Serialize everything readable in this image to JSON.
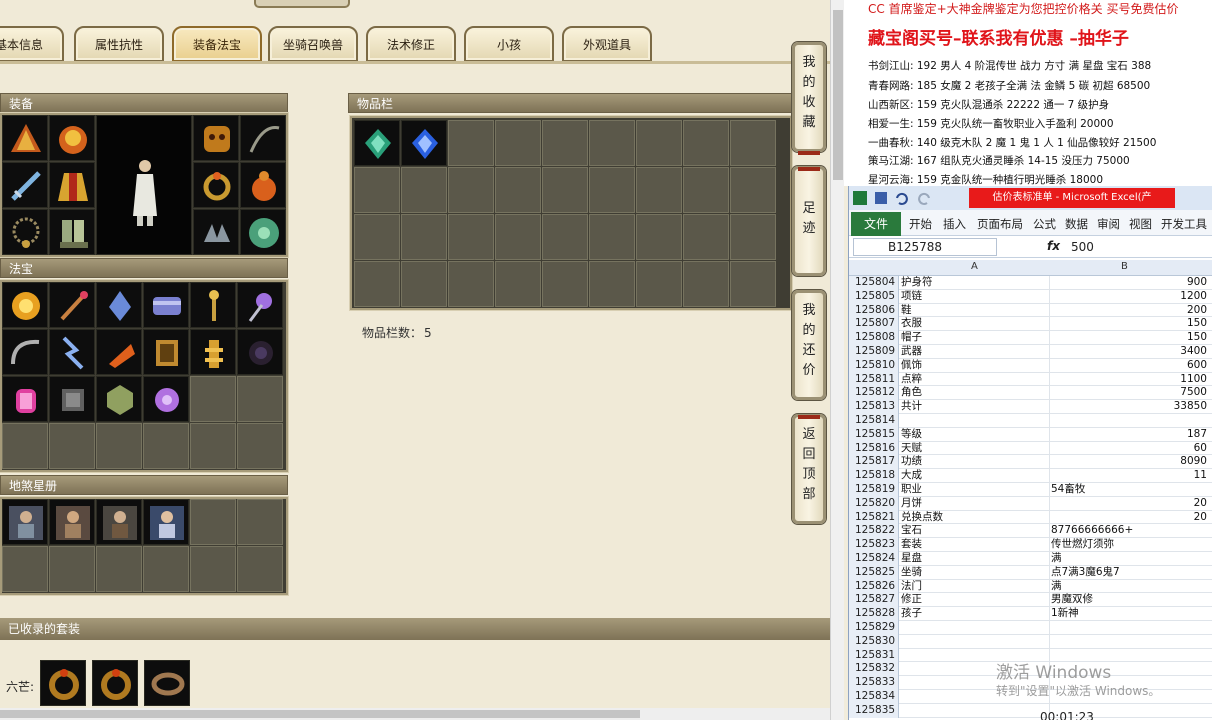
{
  "tabs": [
    {
      "label": "基本信息"
    },
    {
      "label": "属性抗性"
    },
    {
      "label": "装备法宝"
    },
    {
      "label": "坐骑召唤兽"
    },
    {
      "label": "法术修正"
    },
    {
      "label": "小孩"
    },
    {
      "label": "外观道具"
    }
  ],
  "active_tab": "装备法宝",
  "sections": {
    "equipment": "装备",
    "treasure": "法宝",
    "stars": "地煞星册",
    "inventory": "物品栏",
    "suits": "已收录的套装"
  },
  "inventory_count_label": "物品栏数：",
  "inventory_count": "5",
  "suit_row_label": "六芒:",
  "side_buttons": [
    {
      "label": "我的收藏"
    },
    {
      "label": "足迹"
    },
    {
      "label": "我的还价"
    },
    {
      "label": "返回顶部"
    }
  ],
  "ad": {
    "line0": "CC 首席鉴定+大神金牌鉴定为您把控价格关 买号免费估价",
    "headline": "藏宝阁买号–联系我有优惠 –抽华子",
    "listings": [
      "书剑江山: 192 男人 4 阶混传世 战力 方寸 满 星盘 宝石 388",
      "青春网路: 185 女魔 2 老孩子全满 法 金鳞 5 碳 初超 68500",
      "山西新区: 159 克火队混通杀 22222 通一 7 级护身",
      "相爱一生: 159 克火队统一畜牧职业入手盈利 20000",
      "一曲春秋: 140 级克木队 2 魔 1 鬼 1 人 1 仙品像较好 21500",
      "策马江湖: 167 组队克火通灵睡杀 14-15 没压力 75000",
      "星河云海: 159 克金队统一种植行明光睡杀 18000"
    ]
  },
  "excel": {
    "title": "估价表标准单 - Microsoft Excel(产",
    "ribbon": [
      "文件",
      "开始",
      "插入",
      "页面布局",
      "公式",
      "数据",
      "审阅",
      "视图",
      "开发工具"
    ],
    "name_box": "B125788",
    "fx": "fx",
    "formula_value": "500",
    "columns": [
      "A",
      "B"
    ],
    "rows": [
      {
        "n": "125804",
        "a": "护身符",
        "b": "900"
      },
      {
        "n": "125805",
        "a": "项链",
        "b": "1200"
      },
      {
        "n": "125806",
        "a": "鞋",
        "b": "200"
      },
      {
        "n": "125807",
        "a": "衣服",
        "b": "150"
      },
      {
        "n": "125808",
        "a": "帽子",
        "b": "150"
      },
      {
        "n": "125809",
        "a": "武器",
        "b": "3400"
      },
      {
        "n": "125810",
        "a": "佩饰",
        "b": "600"
      },
      {
        "n": "125811",
        "a": "点粹",
        "b": "1100"
      },
      {
        "n": "125812",
        "a": "角色",
        "b": "7500"
      },
      {
        "n": "125813",
        "a": "共计",
        "b": "33850"
      },
      {
        "n": "125814",
        "a": "",
        "b": ""
      },
      {
        "n": "125815",
        "a": "等级",
        "b": "187"
      },
      {
        "n": "125816",
        "a": "天赋",
        "b": "60"
      },
      {
        "n": "125817",
        "a": "功绩",
        "b": "8090"
      },
      {
        "n": "125818",
        "a": "大成",
        "b": "11"
      },
      {
        "n": "125819",
        "a": "职业",
        "b": "54畜牧",
        "t": true
      },
      {
        "n": "125820",
        "a": "月饼",
        "b": "20"
      },
      {
        "n": "125821",
        "a": "兑换点数",
        "b": "20"
      },
      {
        "n": "125822",
        "a": "宝石",
        "b": "87766666666+",
        "t": true
      },
      {
        "n": "125823",
        "a": "套装",
        "b": "传世燃灯须弥",
        "t": true
      },
      {
        "n": "125824",
        "a": "星盘",
        "b": "满",
        "t": true
      },
      {
        "n": "125825",
        "a": "坐骑",
        "b": "点7满3魔6鬼7",
        "t": true
      },
      {
        "n": "125826",
        "a": "法门",
        "b": "满",
        "t": true
      },
      {
        "n": "125827",
        "a": "修正",
        "b": "男魔双修",
        "t": true
      },
      {
        "n": "125828",
        "a": "孩子",
        "b": "1新神",
        "t": true
      },
      {
        "n": "125829",
        "a": "",
        "b": ""
      },
      {
        "n": "125830",
        "a": "",
        "b": ""
      },
      {
        "n": "125831",
        "a": "",
        "b": ""
      },
      {
        "n": "125832",
        "a": "",
        "b": ""
      },
      {
        "n": "125833",
        "a": "",
        "b": ""
      },
      {
        "n": "125834",
        "a": "",
        "b": ""
      },
      {
        "n": "125835",
        "a": "",
        "b": ""
      }
    ]
  },
  "watermark": {
    "line1": "激活 Windows",
    "line2": "转到\"设置\"以激活 Windows。"
  },
  "timer": "00:01:23",
  "colors": {
    "panel_header": "#8e8266",
    "tab_border": "#7b6a45",
    "ad_red": "#e0141a",
    "excel_green": "#2a7a3c"
  }
}
